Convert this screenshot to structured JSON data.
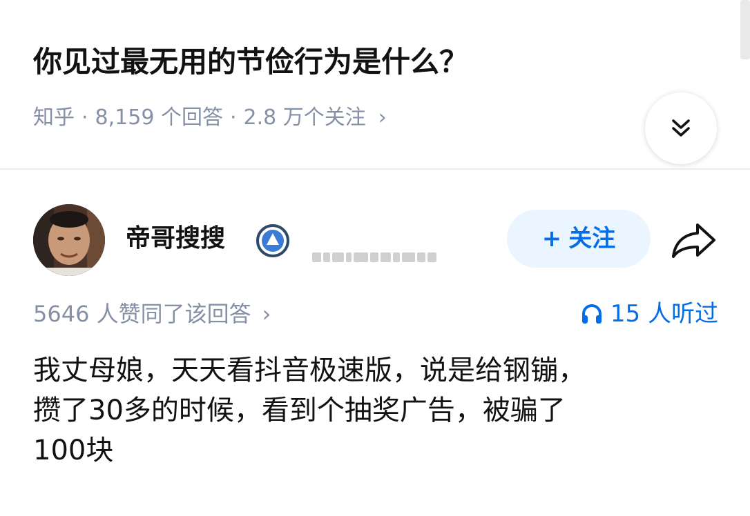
{
  "question": {
    "title": "你见过最无用的节俭行为是什么？",
    "source": "知乎",
    "separator": "·",
    "answer_count": "8,159 个回答",
    "follower_count": "2.8 万个关注",
    "meta_chevron": "›"
  },
  "author": {
    "name": "帝哥搜搜",
    "follow_plus": "+",
    "follow_label": "关注"
  },
  "answer": {
    "votes_text": "5646 人赞同了该回答",
    "votes_chevron": "›",
    "listened_text": "15 人听过",
    "lines": [
      "我丈母娘，天天看抖音极速版，说是给钢镚，",
      "攒了30多的时候，看到个抽奖广告，被骗了",
      "100块"
    ]
  },
  "colors": {
    "accent": "#056de8",
    "meta_gray": "#8590a6",
    "follow_bg": "#ebf5ff",
    "text": "#121212"
  },
  "icons": {
    "expand": "double-chevron-down-icon",
    "verified": "verified-badge-icon",
    "share": "share-arrow-icon",
    "headphones": "headphones-icon"
  }
}
